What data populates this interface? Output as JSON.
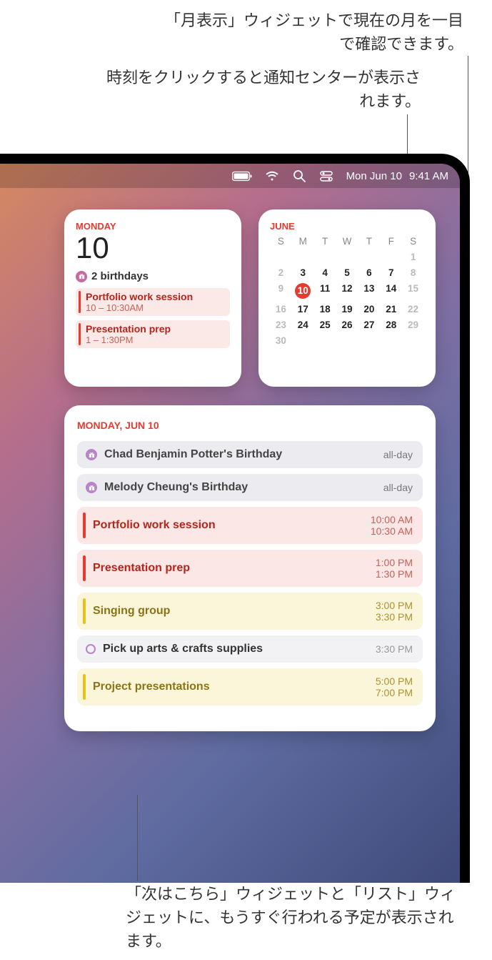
{
  "annotations": {
    "top1": "「月表示」ウィジェットで現在の月を一目で確認できます。",
    "top2": "時刻をクリックすると通知センターが表示されます。",
    "bottom": "「次はこちら」ウィジェットと「リスト」ウィジェットに、もうすぐ行われる予定が表示されます。"
  },
  "menubar": {
    "date": "Mon Jun 10",
    "time": "9:41 AM"
  },
  "upnext": {
    "dayname": "MONDAY",
    "daynum": "10",
    "birthdays_label": "2 birthdays",
    "events": [
      {
        "title": "Portfolio work session",
        "time": "10 – 10:30AM"
      },
      {
        "title": "Presentation prep",
        "time": "1 – 1:30PM"
      }
    ]
  },
  "month": {
    "title": "JUNE",
    "dow": [
      "S",
      "M",
      "T",
      "W",
      "T",
      "F",
      "S"
    ],
    "weeks": [
      [
        "",
        "",
        "",
        "",
        "",
        "",
        "1"
      ],
      [
        "2",
        "3",
        "4",
        "5",
        "6",
        "7",
        "8"
      ],
      [
        "9",
        "10",
        "11",
        "12",
        "13",
        "14",
        "15"
      ],
      [
        "16",
        "17",
        "18",
        "19",
        "20",
        "21",
        "22"
      ],
      [
        "23",
        "24",
        "25",
        "26",
        "27",
        "28",
        "29"
      ],
      [
        "30",
        "",
        "",
        "",
        "",
        "",
        ""
      ]
    ],
    "selected": "10",
    "dim_cols": [
      0,
      6
    ]
  },
  "list": {
    "title": "MONDAY, JUN 10",
    "events": [
      {
        "kind": "birthday",
        "name": "Chad Benjamin Potter's Birthday",
        "time1": "all-day",
        "time2": ""
      },
      {
        "kind": "birthday",
        "name": "Melody Cheung's Birthday",
        "time1": "all-day",
        "time2": ""
      },
      {
        "kind": "red",
        "name": "Portfolio work session",
        "time1": "10:00 AM",
        "time2": "10:30 AM"
      },
      {
        "kind": "red",
        "name": "Presentation prep",
        "time1": "1:00 PM",
        "time2": "1:30 PM"
      },
      {
        "kind": "yellow",
        "name": "Singing group",
        "time1": "3:00 PM",
        "time2": "3:30 PM"
      },
      {
        "kind": "reminder",
        "name": "Pick up arts & crafts supplies",
        "time1": "3:30 PM",
        "time2": ""
      },
      {
        "kind": "yellow",
        "name": "Project presentations",
        "time1": "5:00 PM",
        "time2": "7:00 PM"
      }
    ]
  }
}
